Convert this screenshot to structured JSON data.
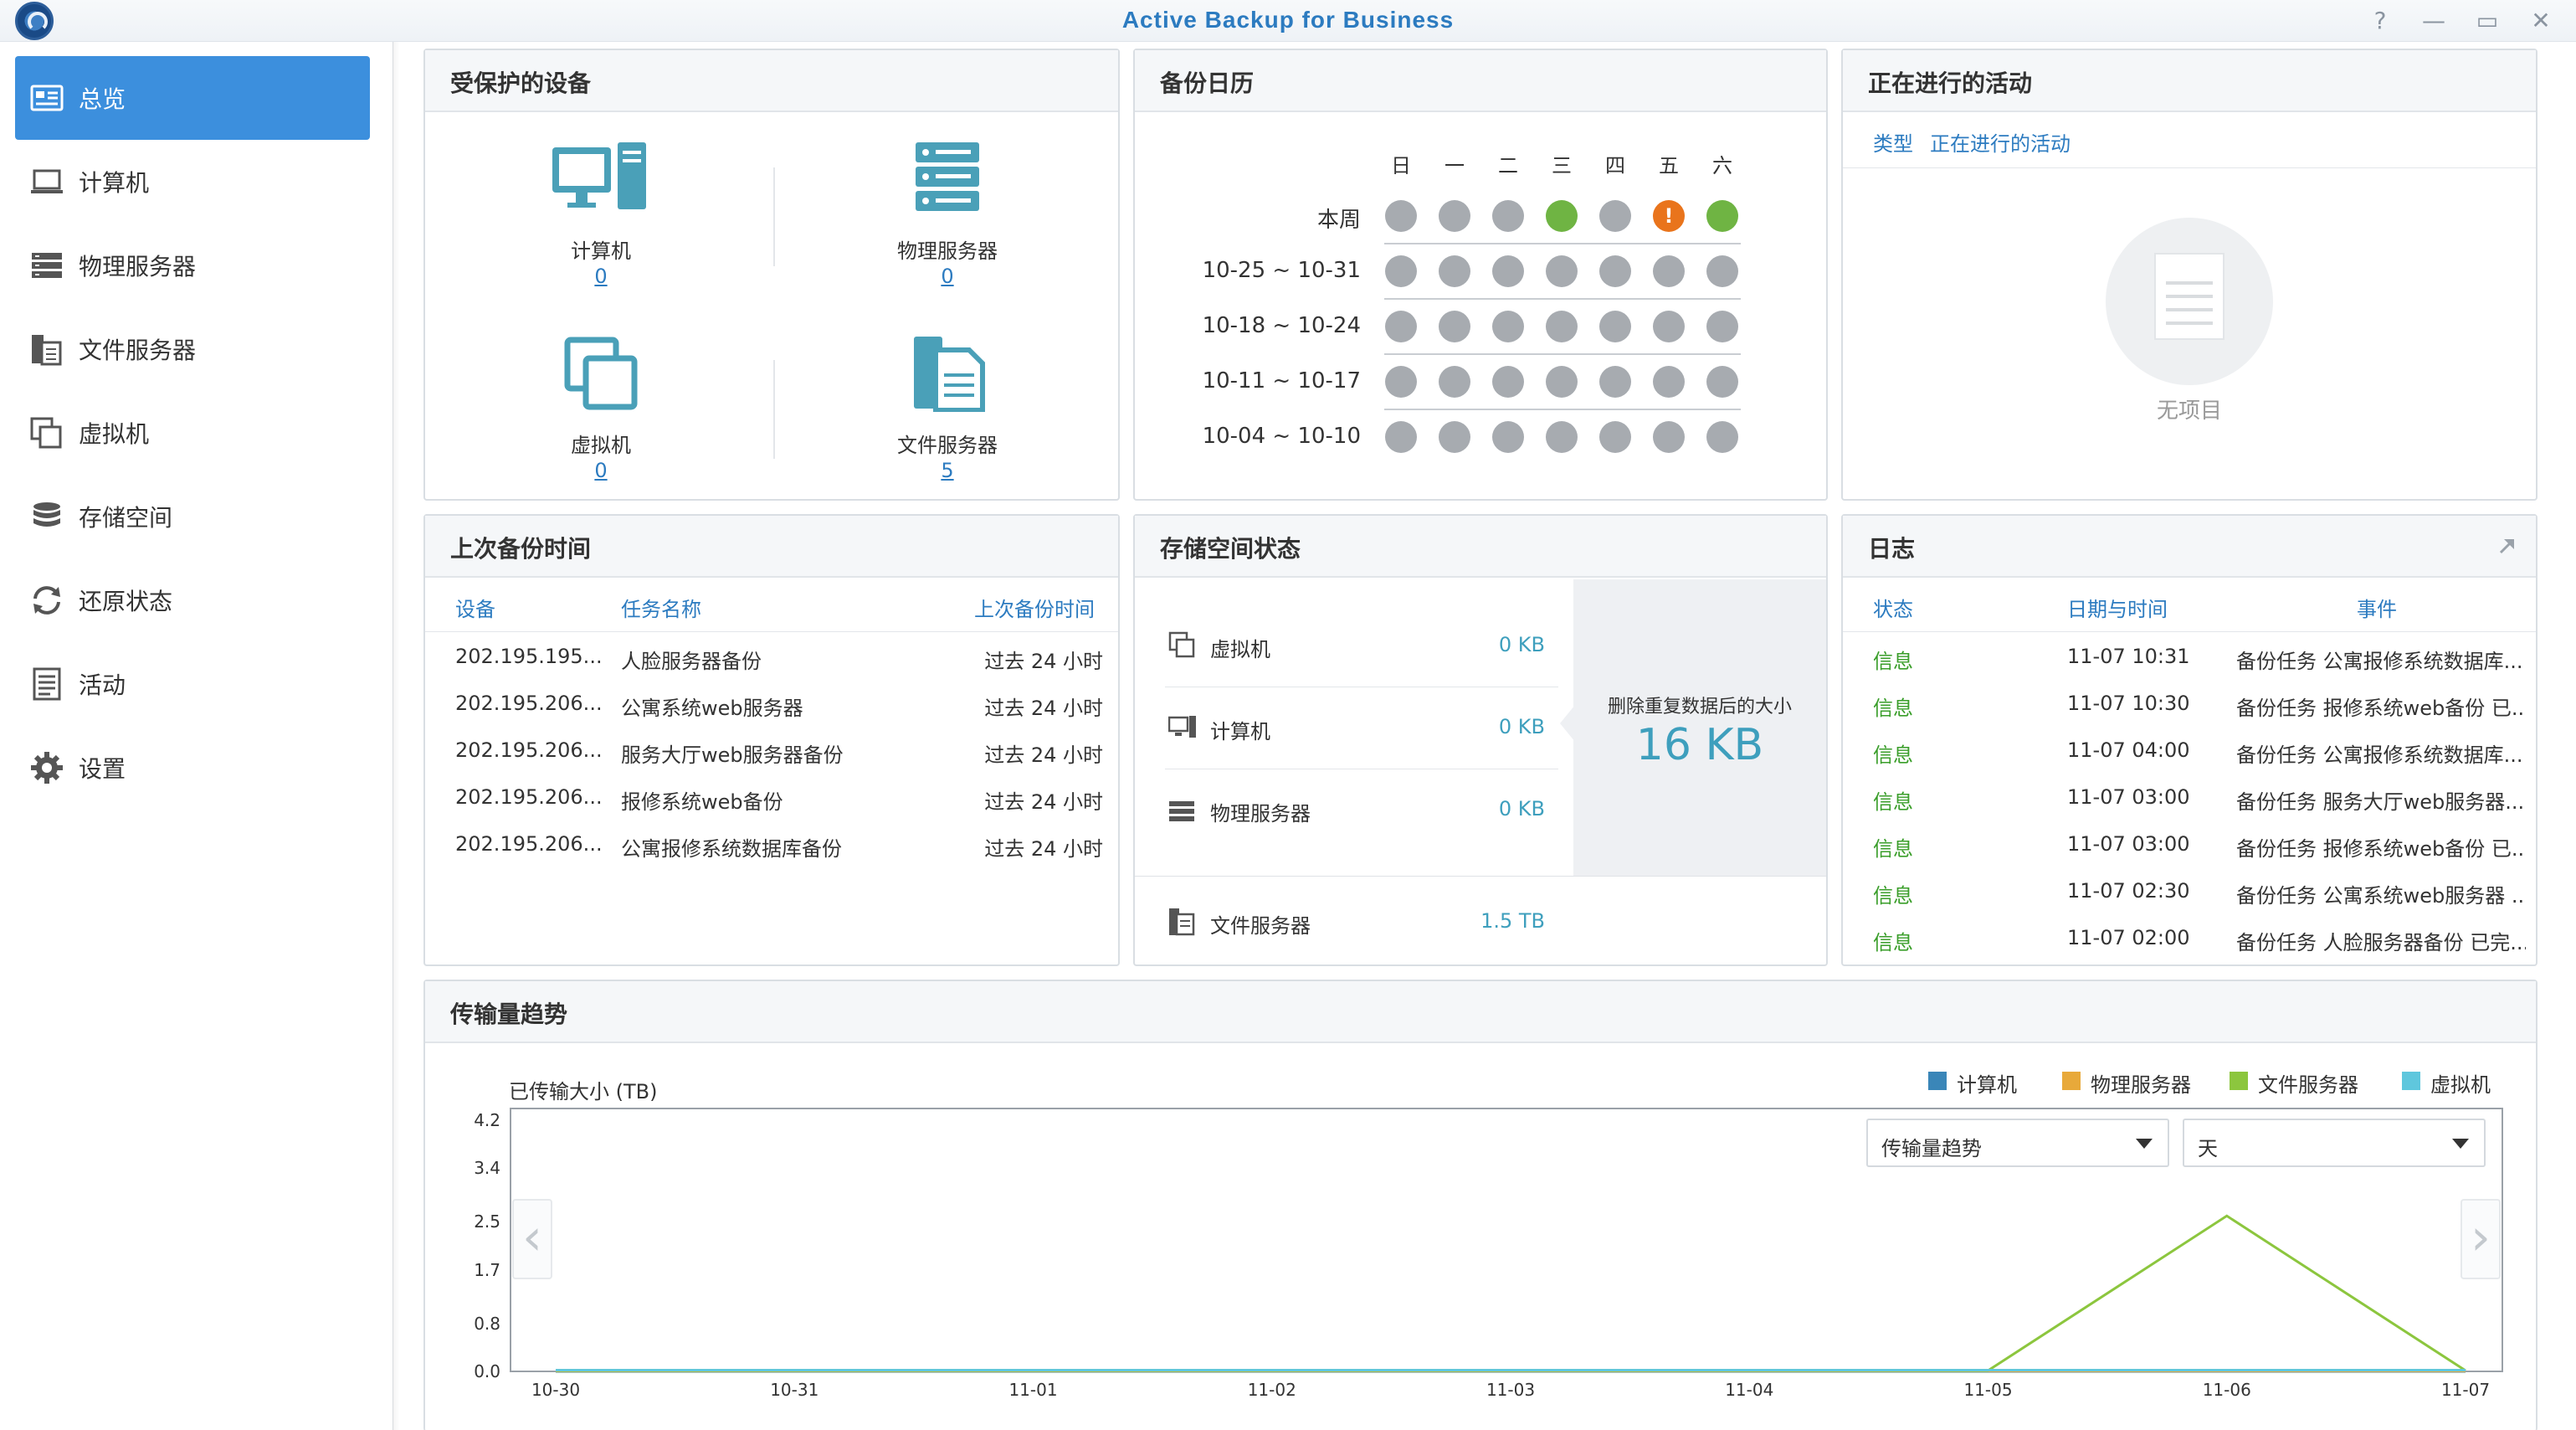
{
  "window": {
    "title": "Active Backup for Business",
    "controls": [
      "?",
      "—",
      "▭",
      "✕"
    ]
  },
  "sidebar": {
    "items": [
      {
        "label": "总览",
        "icon": "overview-icon",
        "active": true
      },
      {
        "label": "计算机",
        "icon": "laptop-icon"
      },
      {
        "label": "物理服务器",
        "icon": "server-icon"
      },
      {
        "label": "文件服务器",
        "icon": "file-server-icon"
      },
      {
        "label": "虚拟机",
        "icon": "virtual-machine-icon"
      },
      {
        "label": "存储空间",
        "icon": "storage-icon"
      },
      {
        "label": "还原状态",
        "icon": "restore-icon"
      },
      {
        "label": "活动",
        "icon": "activity-icon"
      },
      {
        "label": "设置",
        "icon": "gear-icon"
      }
    ]
  },
  "protected_devices": {
    "title": "受保护的设备",
    "devices": [
      {
        "label": "计算机",
        "count": "0"
      },
      {
        "label": "物理服务器",
        "count": "0"
      },
      {
        "label": "虚拟机",
        "count": "0"
      },
      {
        "label": "文件服务器",
        "count": "5"
      }
    ]
  },
  "backup_calendar": {
    "title": "备份日历",
    "weekdays": [
      "日",
      "一",
      "二",
      "三",
      "四",
      "五",
      "六"
    ],
    "rows": [
      {
        "label": "本周",
        "statuses": [
          "none",
          "none",
          "none",
          "success",
          "none",
          "warning",
          "success"
        ]
      },
      {
        "label": "10-25 ~ 10-31",
        "statuses": [
          "none",
          "none",
          "none",
          "none",
          "none",
          "none",
          "none"
        ]
      },
      {
        "label": "10-18 ~ 10-24",
        "statuses": [
          "none",
          "none",
          "none",
          "none",
          "none",
          "none",
          "none"
        ]
      },
      {
        "label": "10-11 ~ 10-17",
        "statuses": [
          "none",
          "none",
          "none",
          "none",
          "none",
          "none",
          "none"
        ]
      },
      {
        "label": "10-04 ~ 10-10",
        "statuses": [
          "none",
          "none",
          "none",
          "none",
          "none",
          "none",
          "none"
        ]
      }
    ],
    "warning_mark": "!"
  },
  "ongoing": {
    "title": "正在进行的活动",
    "col_type": "类型",
    "col_activity": "正在进行的活动",
    "empty_text": "无项目"
  },
  "last_backup": {
    "title": "上次备份时间",
    "headers": {
      "device": "设备",
      "task": "任务名称",
      "time": "上次备份时间"
    },
    "rows": [
      {
        "device": "202.195.195...",
        "task": "人脸服务器备份",
        "time": "过去 24 小时"
      },
      {
        "device": "202.195.206...",
        "task": "公寓系统web服务器",
        "time": "过去 24 小时"
      },
      {
        "device": "202.195.206...",
        "task": "服务大厅web服务器备份",
        "time": "过去 24 小时"
      },
      {
        "device": "202.195.206...",
        "task": "报修系统web备份",
        "time": "过去 24 小时"
      },
      {
        "device": "202.195.206...",
        "task": "公寓报修系统数据库备份",
        "time": "过去 24 小时"
      }
    ]
  },
  "storage_status": {
    "title": "存储空间状态",
    "items": [
      {
        "label": "虚拟机",
        "value": "0 KB",
        "icon": "virtual-machine-icon"
      },
      {
        "label": "计算机",
        "value": "0 KB",
        "icon": "computer-icon"
      },
      {
        "label": "物理服务器",
        "value": "0 KB",
        "icon": "server-icon"
      }
    ],
    "file_server": {
      "label": "文件服务器",
      "value": "1.5 TB",
      "icon": "file-server-icon"
    },
    "dedup_label": "删除重复数据后的大小",
    "dedup_value": "16 KB"
  },
  "logs": {
    "title": "日志",
    "headers": {
      "status": "状态",
      "datetime": "日期与时间",
      "event": "事件"
    },
    "rows": [
      {
        "status": "信息",
        "datetime": "11-07 10:31",
        "event": "备份任务 公寓报修系统数据库..."
      },
      {
        "status": "信息",
        "datetime": "11-07 10:30",
        "event": "备份任务 报修系统web备份 已..."
      },
      {
        "status": "信息",
        "datetime": "11-07 04:00",
        "event": "备份任务 公寓报修系统数据库..."
      },
      {
        "status": "信息",
        "datetime": "11-07 03:00",
        "event": "备份任务 服务大厅web服务器..."
      },
      {
        "status": "信息",
        "datetime": "11-07 03:00",
        "event": "备份任务 报修系统web备份 已..."
      },
      {
        "status": "信息",
        "datetime": "11-07 02:30",
        "event": "备份任务 公寓系统web服务器 ..."
      },
      {
        "status": "信息",
        "datetime": "11-07 02:00",
        "event": "备份任务 人脸服务器备份 已完..."
      }
    ]
  },
  "transfer": {
    "title": "传输量趋势",
    "select_metric": "传输量趋势",
    "select_period": "天"
  },
  "colors": {
    "accent": "#2c7bc0",
    "active_nav": "#3c8fdd",
    "success": "#6fb443",
    "warning": "#e9741c",
    "info": "#3a9e2a"
  },
  "chart_data": {
    "type": "line",
    "title": "",
    "ylabel": "已传输大小 (TB)",
    "xlabel": "",
    "x": [
      "10-30",
      "10-31",
      "11-01",
      "11-02",
      "11-03",
      "11-04",
      "11-05",
      "11-06",
      "11-07"
    ],
    "yticks": [
      "0.0",
      "0.8",
      "1.7",
      "2.5",
      "3.4",
      "4.2"
    ],
    "ylim": [
      0,
      4.2
    ],
    "legend_position": "top-right",
    "series": [
      {
        "name": "计算机",
        "color": "#3a86b8",
        "values": [
          0,
          0,
          0,
          0,
          0,
          0,
          0,
          0,
          0
        ]
      },
      {
        "name": "物理服务器",
        "color": "#e8a93a",
        "values": [
          0,
          0,
          0,
          0,
          0,
          0,
          0,
          0,
          0
        ]
      },
      {
        "name": "文件服务器",
        "color": "#8cc63e",
        "values": [
          0,
          0,
          0,
          0,
          0,
          0,
          0,
          2.6,
          0
        ]
      },
      {
        "name": "虚拟机",
        "color": "#5fc7dd",
        "values": [
          0,
          0,
          0,
          0,
          0,
          0,
          0,
          0,
          0
        ]
      }
    ]
  }
}
